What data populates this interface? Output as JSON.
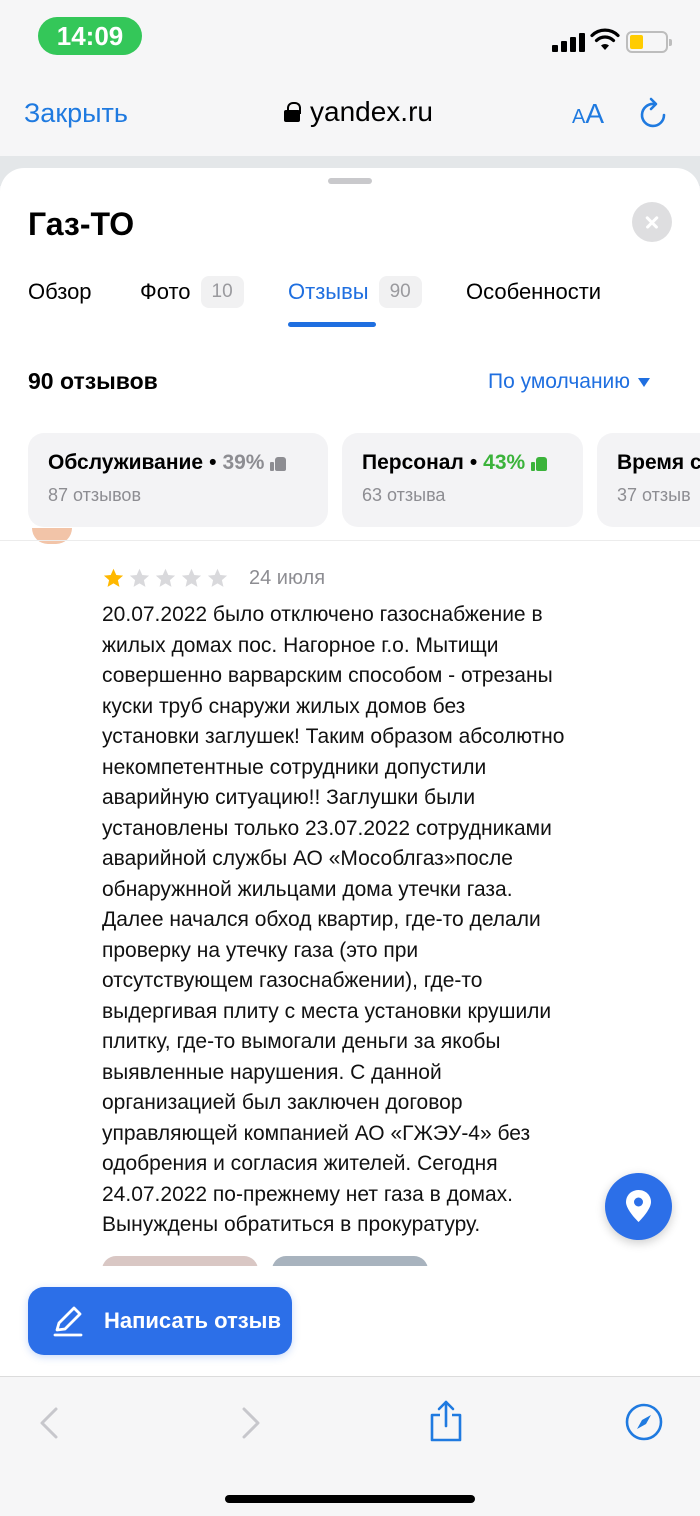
{
  "status_bar": {
    "time": "14:09"
  },
  "browser": {
    "close_label": "Закрыть",
    "url": "yandex.ru",
    "text_size_small": "A",
    "text_size_large": "A"
  },
  "place": {
    "title": "Газ-ТО",
    "tabs": [
      {
        "label": "Обзор",
        "count": ""
      },
      {
        "label": "Фото",
        "count": "10"
      },
      {
        "label": "Отзывы",
        "count": "90"
      },
      {
        "label": "Особенности",
        "count": ""
      }
    ],
    "active_tab": "Отзывы"
  },
  "reviews": {
    "total_label": "90 отзывов",
    "sort_label": "По умолчанию",
    "aspects": [
      {
        "name": "Обслуживание",
        "percent": "39%",
        "sentiment": "neutral",
        "count_label": "87 отзывов"
      },
      {
        "name": "Персонал",
        "percent": "43%",
        "sentiment": "positive",
        "count_label": "63 отзыва"
      },
      {
        "name": "Время с",
        "percent": "",
        "sentiment": "neutral",
        "count_label": "37 отзыв"
      }
    ],
    "item": {
      "rating": 1,
      "max_rating": 5,
      "date": "24 июля",
      "text": "20.07.2022 было отключено газоснабжение в\nжилых домах пос. Нагорное г.о. Мытищи\nсовершенно варварским способом - отрезаны\nкуски труб снаружи жилых домов без\nустановки заглушек! Таким образом абсолютно\nнекомпетентные сотрудники допустили\nаварийную ситуацию!! Заглушки были\nустановлены только 23.07.2022 сотрудниками\nаварийной службы АО «Мособлгаз»после\nобнаружнной жильцами дома утечки газа.\nДалее начался обход квартир, где-то делали\nпроверку на утечку газа (это при\nотсутствующем газоснабжении), где-то\nвыдергивая плиту с места установки крушили\nплитку, где-то вымогали деньги за якобы\nвыявленные нарушения. С данной\nорганизацией был заключен договор\nуправляющей компанией АО «ГЖЭУ-4» без\nодобрения и согласия жителей. Сегодня\n24.07.2022 по-прежнему нет газа в домах.\nВынуждены обратиться в прокуратуру."
    },
    "write_button_label": "Написать отзыв"
  },
  "colors": {
    "accent": "#1f6fe0",
    "button": "#2c6fe8",
    "star_filled": "#ffb800",
    "star_empty": "#d9d9dc",
    "positive": "#3bb33b",
    "time_pill": "#34c759"
  },
  "icons": {
    "lock": "lock-icon",
    "reload": "reload-icon",
    "close": "close-icon",
    "thumb_up": "thumb-up-icon",
    "pencil": "pencil-icon",
    "geo": "location-pin-icon",
    "back": "chevron-left-icon",
    "forward": "chevron-right-icon",
    "share": "share-icon",
    "compass": "compass-icon"
  }
}
